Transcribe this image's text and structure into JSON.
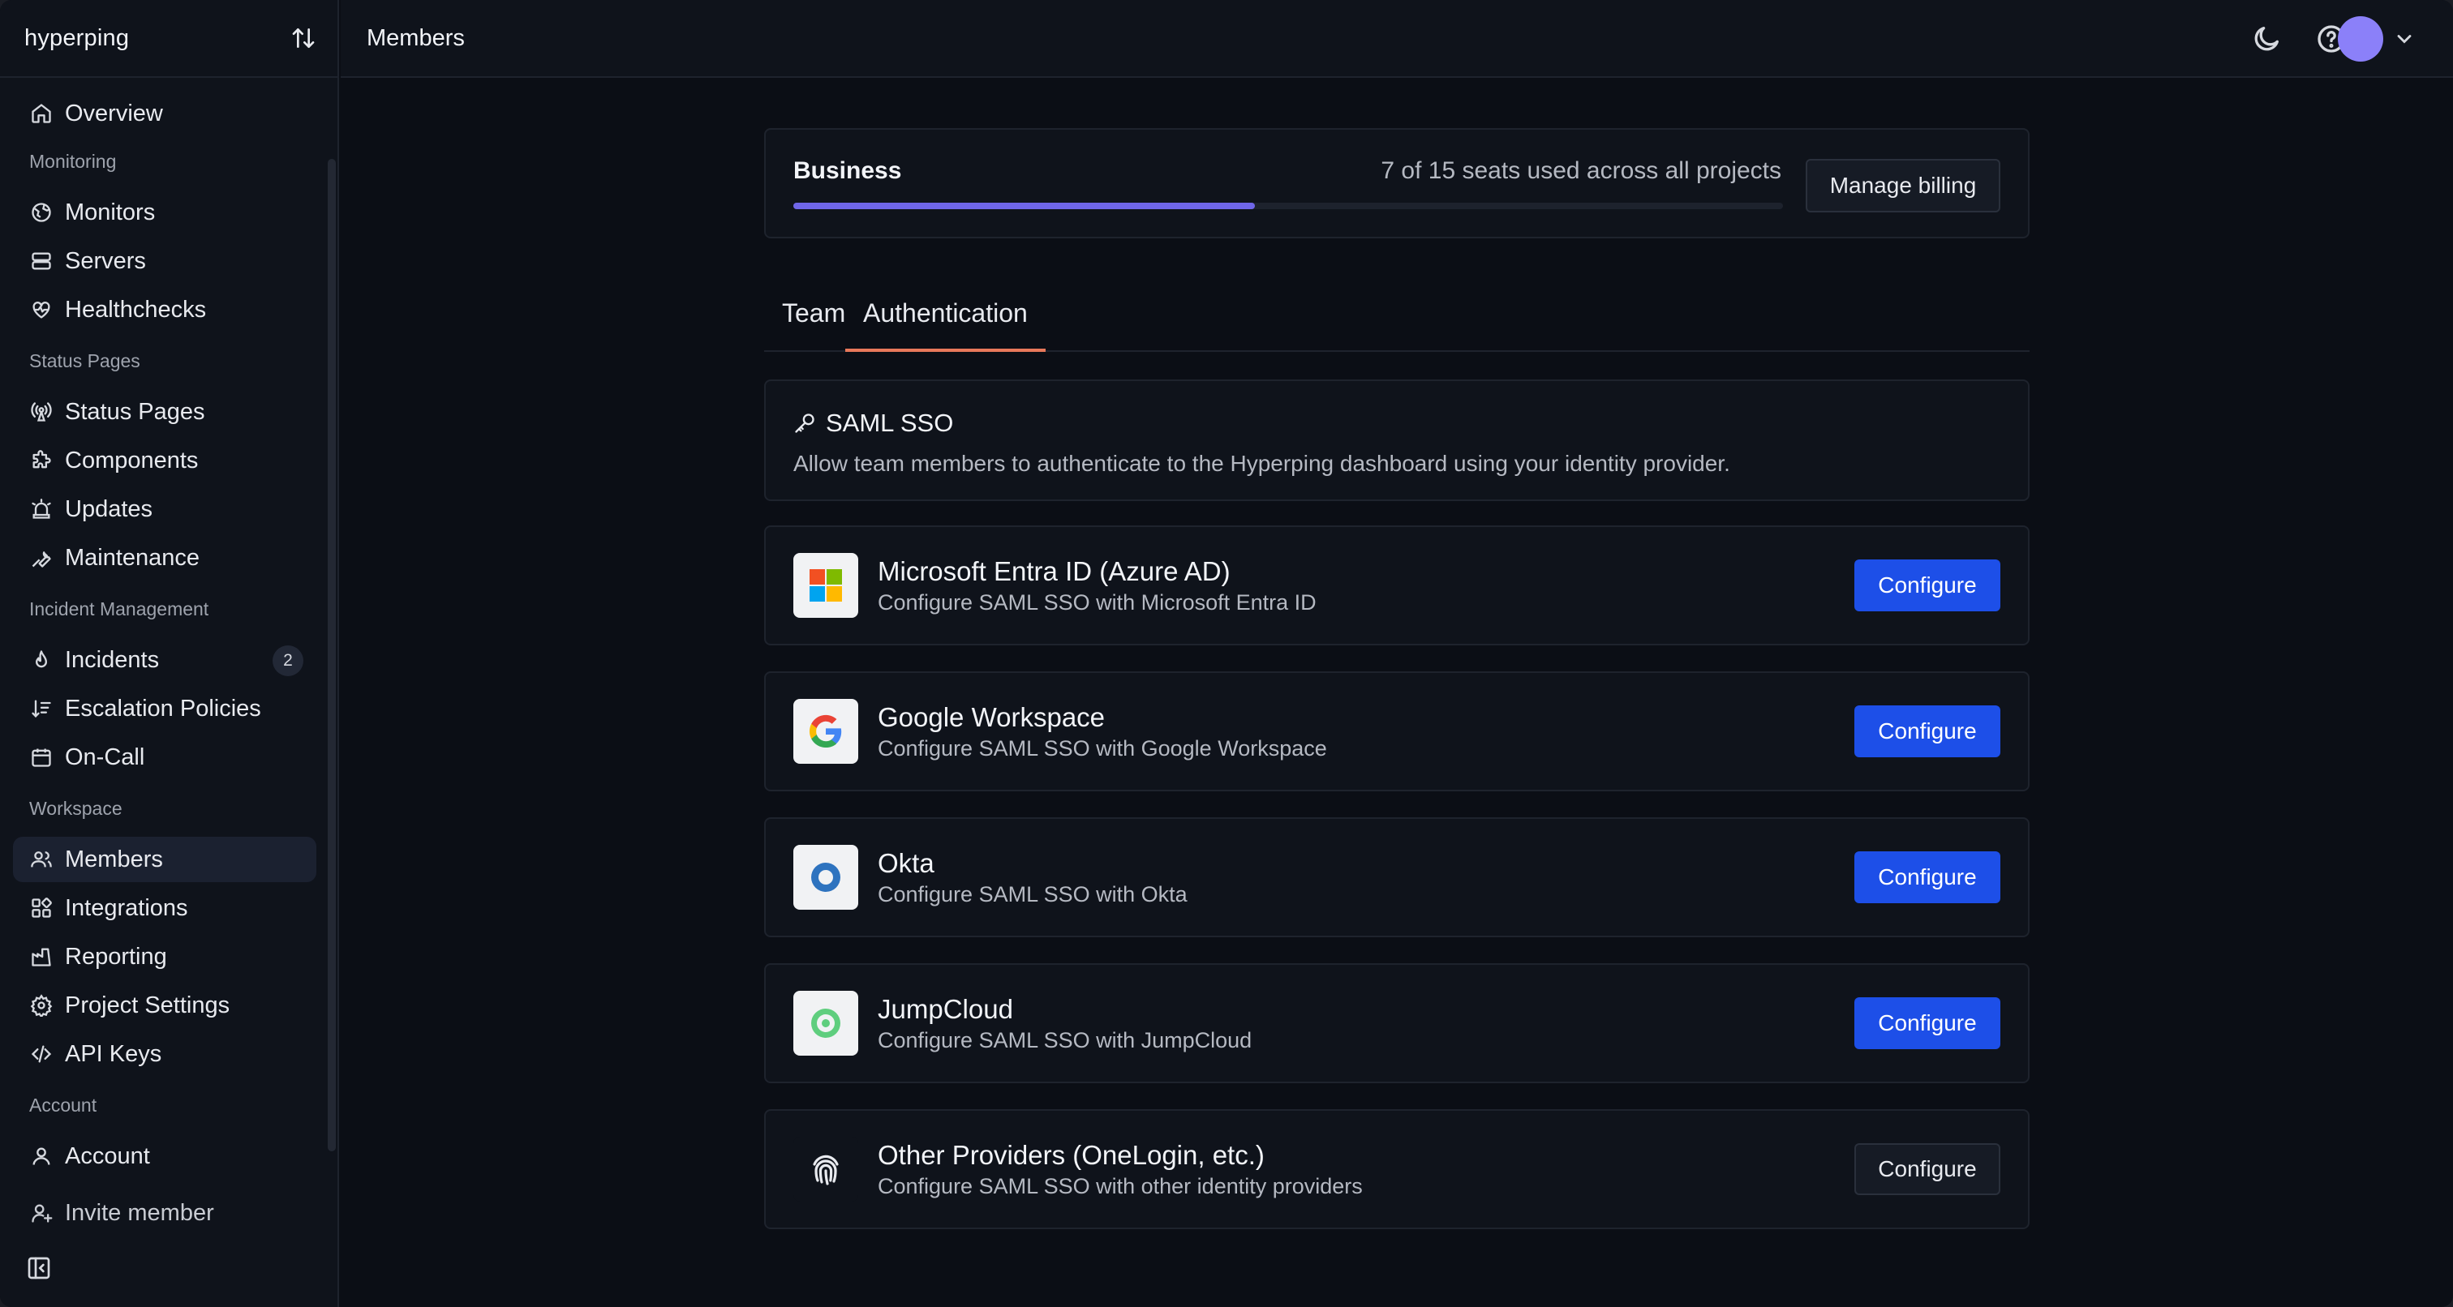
{
  "app": {
    "name": "hyperping"
  },
  "header": {
    "title": "Members"
  },
  "sidebar": {
    "overview": "Overview",
    "sections": {
      "monitoring": "Monitoring",
      "status_pages": "Status Pages",
      "incident_management": "Incident Management",
      "workspace": "Workspace",
      "account": "Account"
    },
    "items": {
      "monitors": "Monitors",
      "servers": "Servers",
      "healthchecks": "Healthchecks",
      "status_pages": "Status Pages",
      "components": "Components",
      "updates": "Updates",
      "maintenance": "Maintenance",
      "incidents": "Incidents",
      "incidents_badge": "2",
      "escalation_policies": "Escalation Policies",
      "on_call": "On-Call",
      "members": "Members",
      "integrations": "Integrations",
      "reporting": "Reporting",
      "project_settings": "Project Settings",
      "api_keys": "API Keys",
      "account": "Account"
    },
    "invite_member": "Invite member"
  },
  "plan": {
    "name": "Business",
    "seats_text": "7 of 15 seats used across all projects",
    "seats_used": 7,
    "seats_total": 15,
    "manage_billing": "Manage billing"
  },
  "tabs": [
    {
      "label": "Team",
      "active": false
    },
    {
      "label": "Authentication",
      "active": true
    }
  ],
  "saml": {
    "title": "SAML SSO",
    "description": "Allow team members to authenticate to the Hyperping dashboard using your identity provider."
  },
  "providers": [
    {
      "name": "Microsoft Entra ID (Azure AD)",
      "description": "Configure SAML SSO with Microsoft Entra ID",
      "button": "Configure",
      "icon": "microsoft-icon"
    },
    {
      "name": "Google Workspace",
      "description": "Configure SAML SSO with Google Workspace",
      "button": "Configure",
      "icon": "google-icon"
    },
    {
      "name": "Okta",
      "description": "Configure SAML SSO with Okta",
      "button": "Configure",
      "icon": "okta-icon"
    },
    {
      "name": "JumpCloud",
      "description": "Configure SAML SSO with JumpCloud",
      "button": "Configure",
      "icon": "jumpcloud-icon"
    },
    {
      "name": "Other Providers (OneLogin, etc.)",
      "description": "Configure SAML SSO with other identity providers",
      "button": "Configure",
      "icon": "fingerprint-icon"
    }
  ],
  "colors": {
    "accent_primary": "#1d4fe8",
    "progress": "#6f66e8",
    "tab_indicator": "#e8785a",
    "avatar": "#8b80f9"
  }
}
